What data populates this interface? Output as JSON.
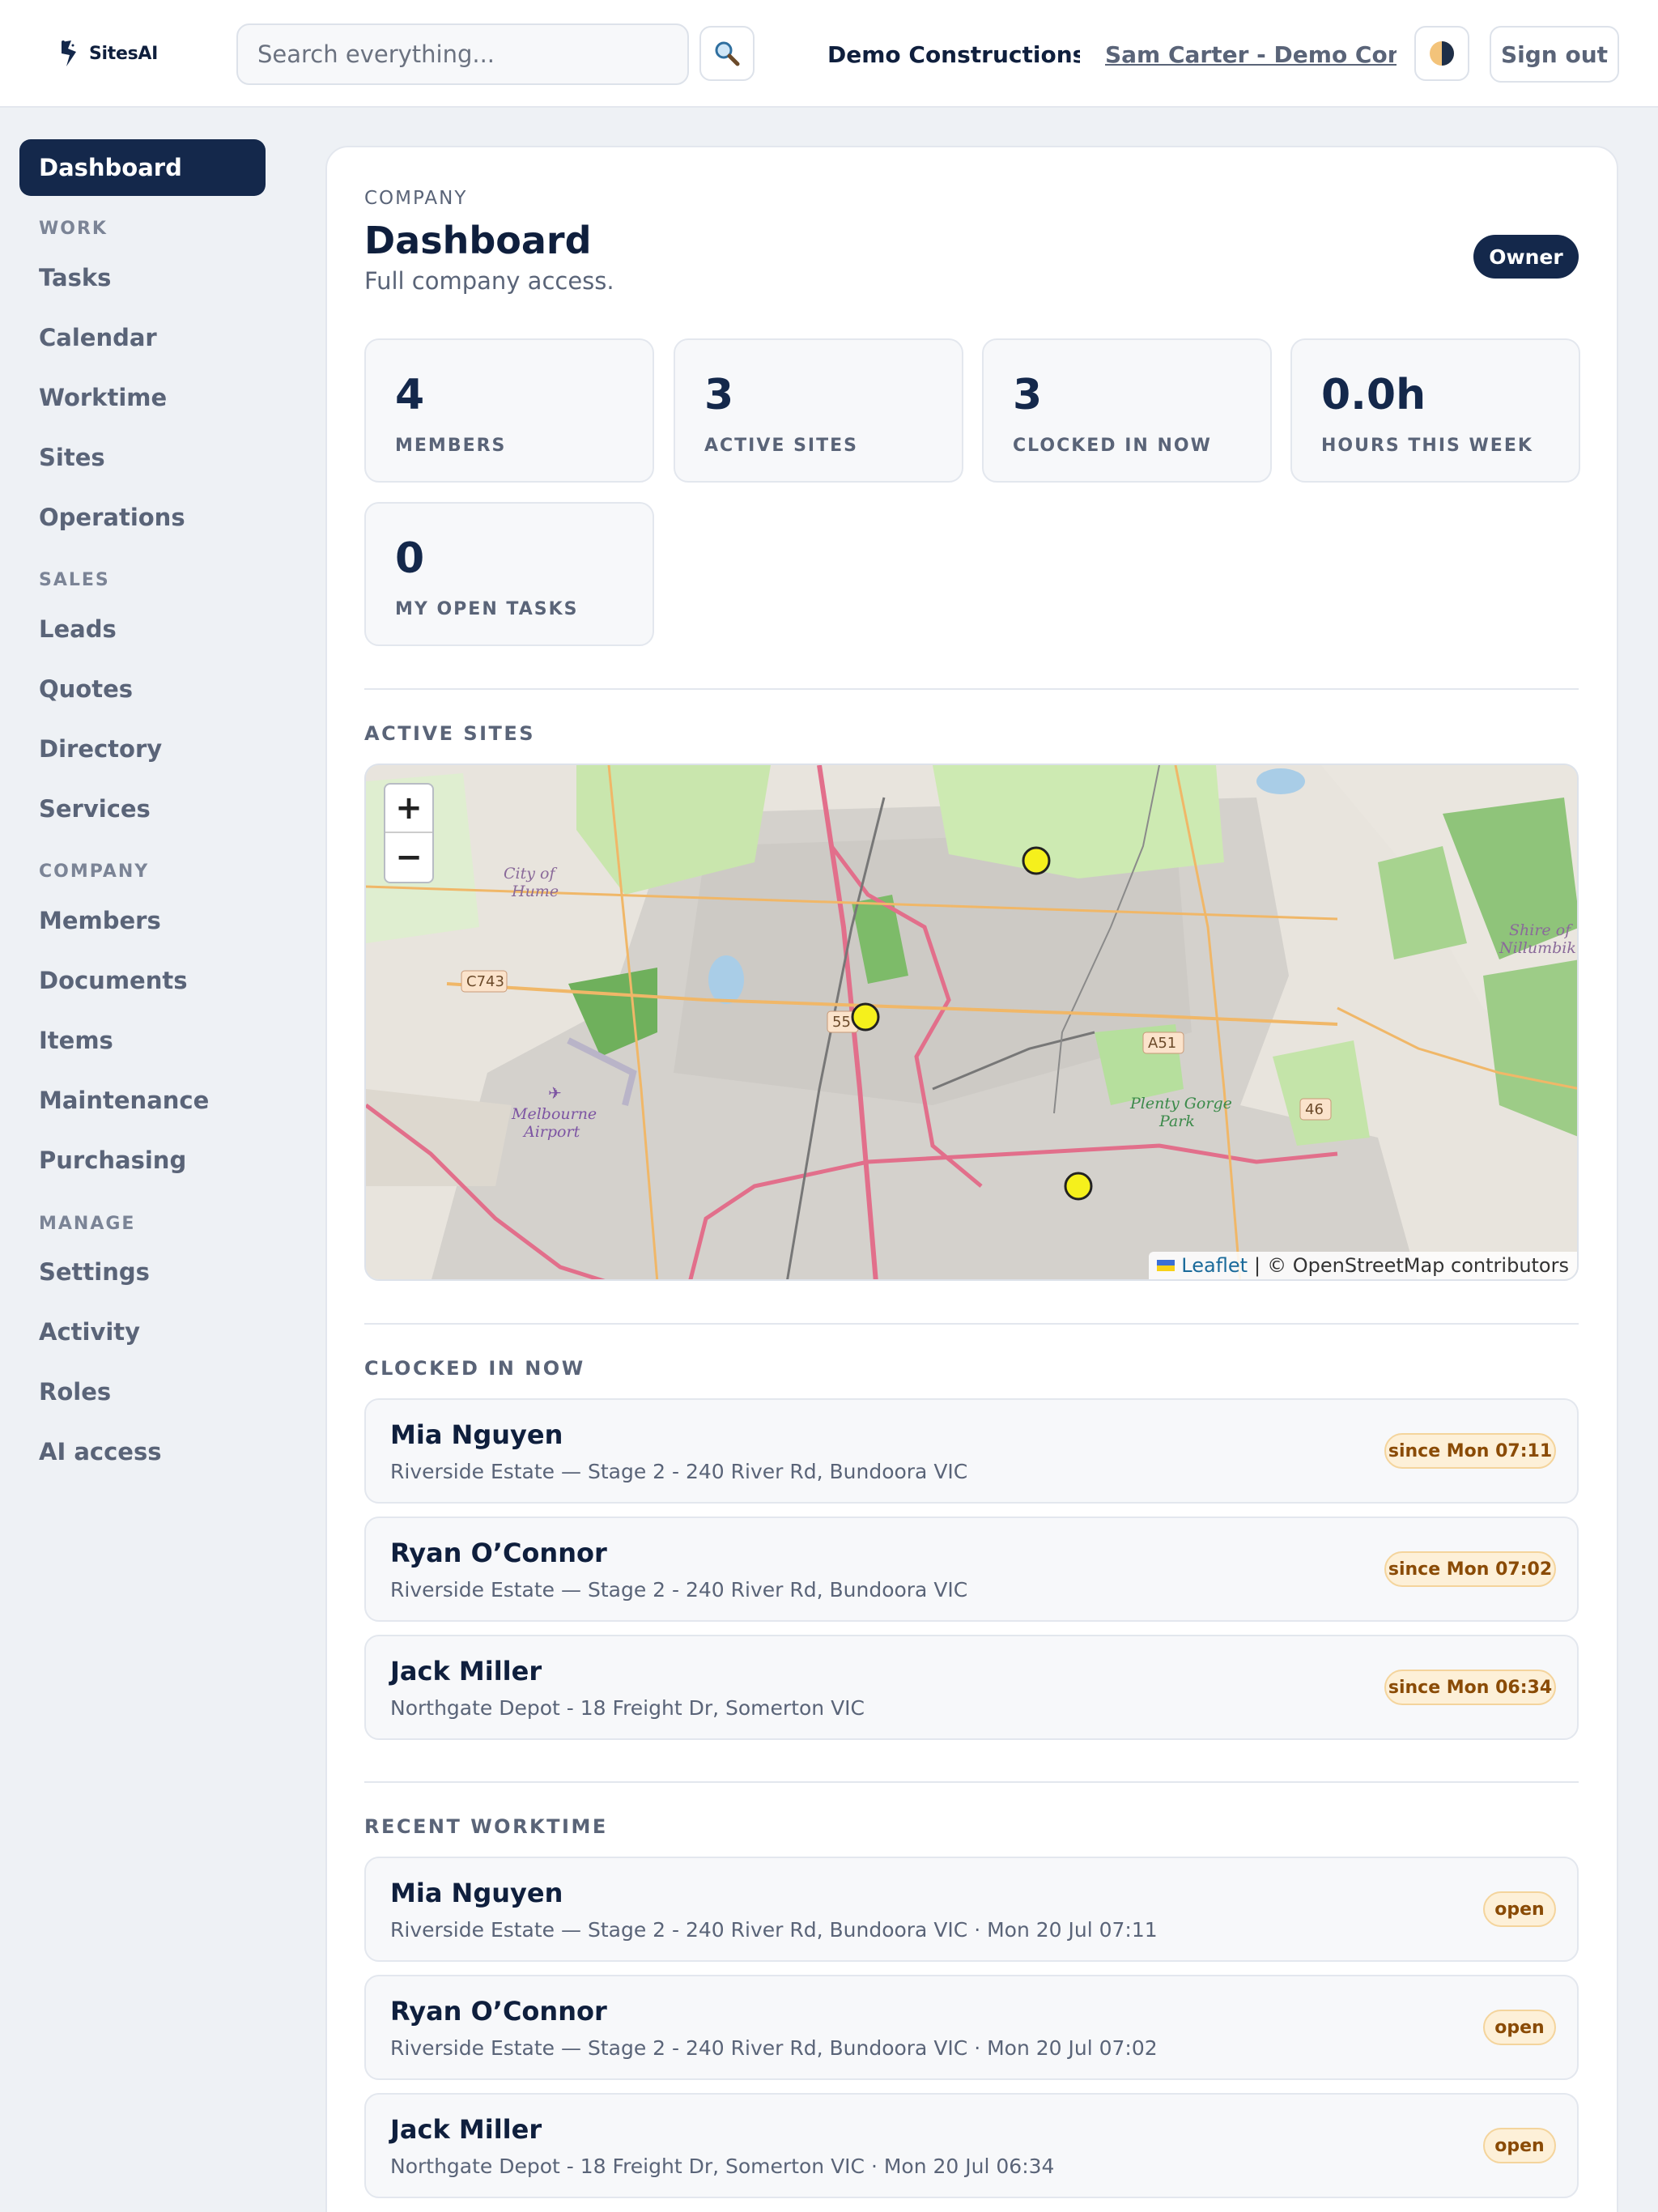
{
  "header": {
    "logo_text": "SitesAI",
    "search_placeholder": "Search everything...",
    "company": "Demo Constructions P...",
    "user": "Sam Carter - Demo Constr...",
    "signout": "Sign out"
  },
  "sidebar": {
    "active": "Dashboard",
    "sections": {
      "work": "WORK",
      "sales": "SALES",
      "company": "COMPANY",
      "manage": "MANAGE"
    },
    "items": {
      "tasks": "Tasks",
      "calendar": "Calendar",
      "worktime": "Worktime",
      "sites": "Sites",
      "operations": "Operations",
      "leads": "Leads",
      "quotes": "Quotes",
      "directory": "Directory",
      "services": "Services",
      "members": "Members",
      "documents": "Documents",
      "items": "Items",
      "maintenance": "Maintenance",
      "purchasing": "Purchasing",
      "settings": "Settings",
      "activity": "Activity",
      "roles": "Roles",
      "ai_access": "AI access"
    }
  },
  "page": {
    "eyebrow": "COMPANY",
    "title": "Dashboard",
    "subtitle": "Full company access.",
    "role_badge": "Owner"
  },
  "stats": [
    {
      "value": "4",
      "label": "MEMBERS"
    },
    {
      "value": "3",
      "label": "ACTIVE SITES"
    },
    {
      "value": "3",
      "label": "CLOCKED IN NOW"
    },
    {
      "value": "0.0h",
      "label": "HOURS THIS WEEK"
    },
    {
      "value": "0",
      "label": "MY OPEN TASKS"
    }
  ],
  "map": {
    "heading": "ACTIVE SITES",
    "zoom_in": "+",
    "zoom_out": "−",
    "attribution_leaflet": "Leaflet",
    "attribution_sep": "|",
    "attribution_osm": "© OpenStreetMap contributors",
    "labels": {
      "city_of_hume_1": "City of",
      "city_of_hume_2": "Hume",
      "shire_1": "Shire of",
      "shire_2": "Nillumbik",
      "airport_1": "Melbourne",
      "airport_2": "Airport",
      "plenty_1": "Plenty Gorge",
      "plenty_2": "Park",
      "c743": "C743",
      "r55": "55",
      "a51": "A51",
      "r46": "46"
    }
  },
  "clocked_in": {
    "heading": "CLOCKED IN NOW",
    "rows": [
      {
        "name": "Mia Nguyen",
        "site": "Riverside Estate — Stage 2 - 240 River Rd, Bundoora VIC",
        "since": "since Mon 07:11"
      },
      {
        "name": "Ryan O’Connor",
        "site": "Riverside Estate — Stage 2 - 240 River Rd, Bundoora VIC",
        "since": "since Mon 07:02"
      },
      {
        "name": "Jack Miller",
        "site": "Northgate Depot - 18 Freight Dr, Somerton VIC",
        "since": "since Mon 06:34"
      }
    ]
  },
  "recent_worktime": {
    "heading": "RECENT WORKTIME",
    "rows": [
      {
        "name": "Mia Nguyen",
        "detail": "Riverside Estate — Stage 2 - 240 River Rd, Bundoora VIC · Mon 20 Jul 07:11",
        "status": "open"
      },
      {
        "name": "Ryan O’Connor",
        "detail": "Riverside Estate — Stage 2 - 240 River Rd, Bundoora VIC · Mon 20 Jul 07:02",
        "status": "open"
      },
      {
        "name": "Jack Miller",
        "detail": "Northgate Depot - 18 Freight Dr, Somerton VIC · Mon 20 Jul 06:34",
        "status": "open"
      }
    ]
  }
}
